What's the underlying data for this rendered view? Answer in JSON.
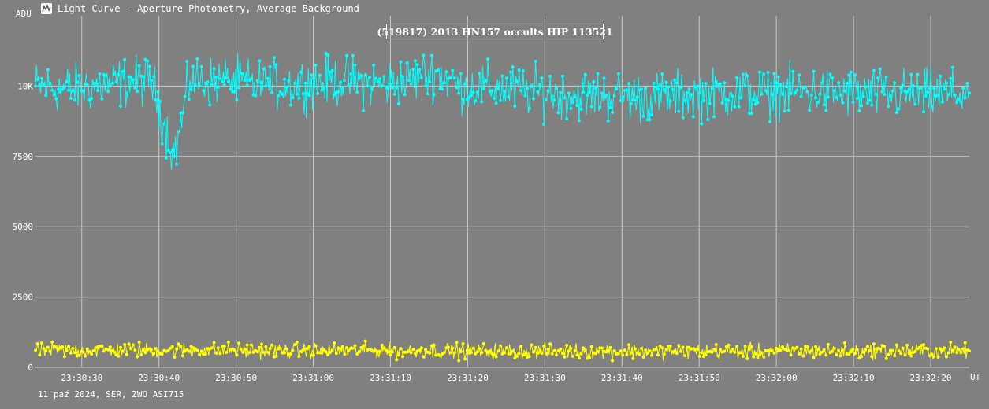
{
  "window": {
    "title": "Light Curve - Aperture Photometry, Average Background",
    "icon": "light-curve-icon"
  },
  "footer": {
    "text": "11 paź 2024, SER, ZWO ASI715"
  },
  "chart_data": {
    "type": "line",
    "title": "(519817) 2013 HN157 occults HIP 113521",
    "xlabel": "UT",
    "ylabel": "ADU",
    "x_range": [
      "23:30:24",
      "23:32:25"
    ],
    "ylim": [
      0,
      12500
    ],
    "x_ticks": [
      "23:30:30",
      "23:30:40",
      "23:30:50",
      "23:31:00",
      "23:31:10",
      "23:31:20",
      "23:31:30",
      "23:31:40",
      "23:31:50",
      "23:32:00",
      "23:32:10",
      "23:32:20"
    ],
    "y_ticks": [
      0,
      2500,
      5000,
      7500,
      10000
    ],
    "y_tick_labels": [
      "0",
      "2500",
      "5000",
      "7500",
      "10K"
    ],
    "grid": true,
    "colors": {
      "background": "#808080",
      "grid": "#c8c8c8",
      "target": "#00ffff",
      "background_series": "#ffff00"
    },
    "series": [
      {
        "color": "#00ffff",
        "x": [
          "23:30:24",
          "23:30:29",
          "23:30:34",
          "23:30:39",
          "23:30:42",
          "23:30:44",
          "23:30:49",
          "23:30:54",
          "23:30:59",
          "23:31:04",
          "23:31:09",
          "23:31:14",
          "23:31:16",
          "23:31:19",
          "23:31:24",
          "23:31:29",
          "23:31:34",
          "23:31:39",
          "23:31:44",
          "23:31:49",
          "23:31:54",
          "23:31:59",
          "23:32:04",
          "23:32:09",
          "23:32:14",
          "23:32:19",
          "23:32:25"
        ],
        "values": [
          10000,
          9900,
          10100,
          10200,
          7500,
          10200,
          10150,
          10000,
          10100,
          10200,
          10050,
          10300,
          10500,
          10000,
          9900,
          9800,
          9700,
          9650,
          9600,
          9700,
          9750,
          9800,
          9800,
          9750,
          9700,
          9700,
          9750
        ],
        "spread": 650
      },
      {
        "color": "#ffff00",
        "x": [
          "23:30:24",
          "23:30:39",
          "23:30:54",
          "23:31:09",
          "23:31:24",
          "23:31:39",
          "23:31:54",
          "23:32:09",
          "23:32:25"
        ],
        "values": [
          600,
          620,
          600,
          590,
          580,
          580,
          570,
          580,
          580
        ],
        "spread": 200
      }
    ]
  }
}
